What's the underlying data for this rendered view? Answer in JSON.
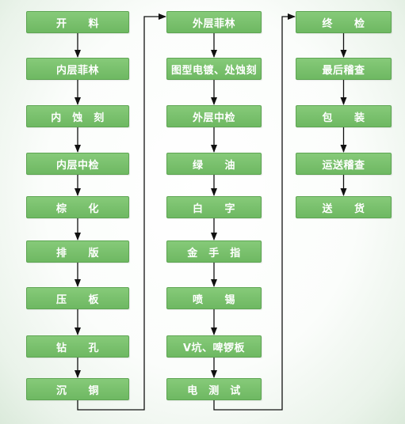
{
  "flowchart": {
    "columns": [
      {
        "steps": [
          "开　　料",
          "内层菲林",
          "内　蚀　刻",
          "内层中检",
          "棕　　化",
          "排　　版",
          "压　　板",
          "钻　　孔",
          "沉　　铜"
        ]
      },
      {
        "steps": [
          "外层菲林",
          "图型电镀、处蚀刻",
          "外层中检",
          "绿　　油",
          "白　　字",
          "金　手　指",
          "喷　　锡",
          "V坑、啤锣板",
          "电　测　试"
        ]
      },
      {
        "steps": [
          "终　　检",
          "最后稽查",
          "包　　装",
          "运送稽查",
          "送　　货"
        ]
      }
    ]
  }
}
